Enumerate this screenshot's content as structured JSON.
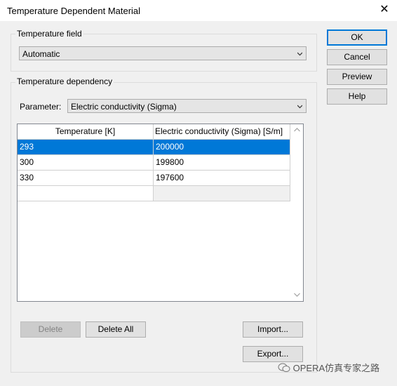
{
  "window": {
    "title": "Temperature Dependent Material",
    "close_symbol": "✕"
  },
  "temperature_field": {
    "label": "Temperature field",
    "value": "Automatic"
  },
  "temperature_dependency": {
    "label": "Temperature dependency",
    "parameter_label": "Parameter:",
    "parameter_value": "Electric conductivity (Sigma)"
  },
  "table": {
    "headers": [
      "Temperature [K]",
      "Electric conductivity (Sigma) [S/m]"
    ],
    "rows": [
      [
        "293",
        "200000"
      ],
      [
        "300",
        "199800"
      ],
      [
        "330",
        "197600"
      ]
    ],
    "selected_row": 0
  },
  "buttons": {
    "ok": "OK",
    "cancel": "Cancel",
    "preview": "Preview",
    "help": "Help",
    "delete": "Delete",
    "delete_all": "Delete All",
    "import": "Import...",
    "export": "Export..."
  },
  "watermark": "OPERA仿真专家之路",
  "colors": {
    "selection": "#0078d7",
    "default_button_border": "#0078d7",
    "dialog_bg": "#f0f0f0"
  }
}
